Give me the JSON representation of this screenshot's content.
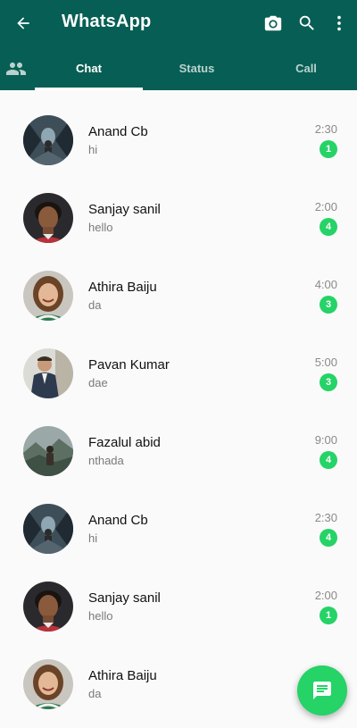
{
  "app": {
    "title": "WhatsApp"
  },
  "header": {
    "actions": [
      {
        "icon": "camera-icon"
      },
      {
        "icon": "search-icon"
      },
      {
        "icon": "more-vert-icon"
      }
    ]
  },
  "tabs": [
    {
      "label": "Chat",
      "active": true
    },
    {
      "label": "Status",
      "active": false
    },
    {
      "label": "Call",
      "active": false
    }
  ],
  "colors": {
    "primary": "#075e54",
    "accent": "#25d366",
    "background": "#fafafa"
  },
  "chats": [
    {
      "name": "Anand Cb",
      "message": "hi",
      "time": "2:30",
      "unread": "1",
      "avatar": "avatar-tunnel"
    },
    {
      "name": "Sanjay sanil",
      "message": "hello",
      "time": "2:00",
      "unread": "4",
      "avatar": "avatar-man-curly"
    },
    {
      "name": "Athira Baiju",
      "message": "da",
      "time": "4:00",
      "unread": "3",
      "avatar": "avatar-woman-smile"
    },
    {
      "name": "Pavan Kumar",
      "message": "dae",
      "time": "5:00",
      "unread": "3",
      "avatar": "avatar-man-suit"
    },
    {
      "name": "Fazalul abid",
      "message": "nthada",
      "time": "9:00",
      "unread": "4",
      "avatar": "avatar-landscape"
    },
    {
      "name": "Anand Cb",
      "message": "hi",
      "time": "2:30",
      "unread": "4",
      "avatar": "avatar-tunnel"
    },
    {
      "name": "Sanjay sanil",
      "message": "hello",
      "time": "2:00",
      "unread": "1",
      "avatar": "avatar-man-curly"
    },
    {
      "name": "Athira Baiju",
      "message": "da",
      "time": "",
      "unread": "",
      "avatar": "avatar-woman-smile"
    }
  ],
  "fab": {
    "icon": "new-chat-icon"
  }
}
